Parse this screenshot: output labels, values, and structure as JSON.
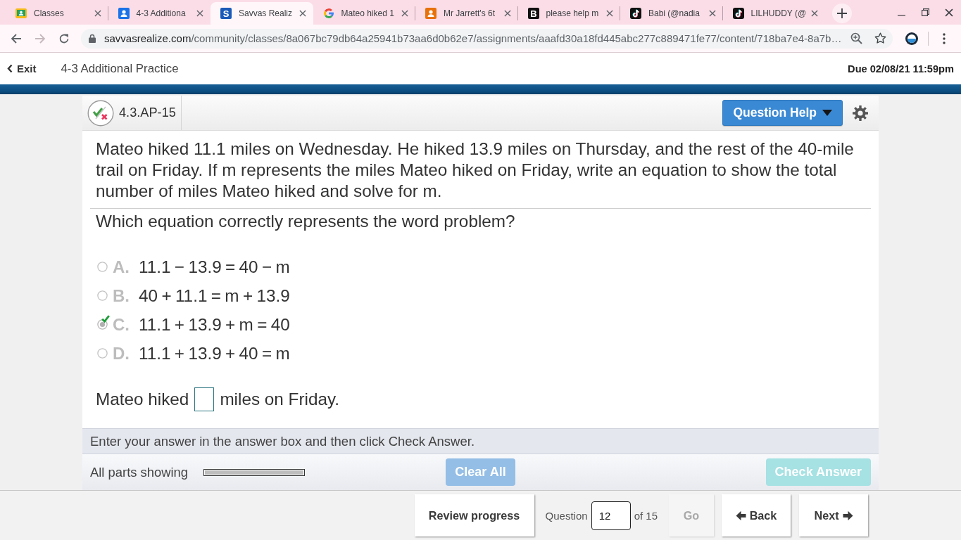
{
  "browser": {
    "tabs": [
      {
        "title": "Classes",
        "selected": false,
        "kind": "classroom"
      },
      {
        "title": "4-3 Additiona",
        "selected": false,
        "kind": "person",
        "color": "#1a73e8"
      },
      {
        "title": "Savvas Realiz",
        "selected": true,
        "kind": "letter",
        "color": "#1a5bb8",
        "icon_letter": "S"
      },
      {
        "title": "Mateo hiked 1",
        "selected": false,
        "kind": "google"
      },
      {
        "title": "Mr Jarrett's 6t",
        "selected": false,
        "kind": "person",
        "color": "#e8710a"
      },
      {
        "title": "please help m",
        "selected": false,
        "kind": "letter",
        "color": "#111111",
        "icon_letter": "B"
      },
      {
        "title": "Babi (@nadia",
        "selected": false,
        "kind": "tiktok"
      },
      {
        "title": "LILHUDDY (@",
        "selected": false,
        "kind": "tiktok"
      }
    ],
    "toolbar": {
      "forward_disabled": true,
      "host": "savvasrealize.com",
      "path": "/community/classes/8a067bc79db64a25941b73aa6d0b62e7/assignments/aaafd30a18fd445abc277c889471fe77/content/718ba7e4-8a7b…"
    }
  },
  "header": {
    "exit": "Exit",
    "title": "4-3 Additional Practice",
    "due": "Due 02/08/21 11:59pm"
  },
  "question": {
    "id": "4.3.AP-15",
    "help_button": "Question Help",
    "problem": "Mateo hiked 11.1 miles on Wednesday. He hiked 13.9 miles on Thursday, and the rest of the 40-mile trail on Friday. If m represents the miles Mateo hiked on Friday, write an equation to show the total number of miles Mateo hiked and solve for m.",
    "prompt": "Which equation correctly represents the word problem?",
    "choices": [
      {
        "letter": "A.",
        "equation": "11.1 − 13.9 = 40 − m",
        "selected": false
      },
      {
        "letter": "B.",
        "equation": "40 + 11.1 = m + 13.9",
        "selected": false
      },
      {
        "letter": "C.",
        "equation": "11.1 + 13.9 + m = 40",
        "selected": true
      },
      {
        "letter": "D.",
        "equation": "11.1 + 13.9 + 40 = m",
        "selected": false
      }
    ],
    "answer_before": "Mateo hiked",
    "answer_after": "miles on Friday.",
    "instruction": "Enter your answer in the answer box and then click Check Answer.",
    "parts_label": "All parts showing",
    "parts_progress": {
      "level": 1
    },
    "buttons": [
      {
        "label": "Clear All",
        "kind": "clear",
        "disabled": true
      },
      {
        "label": "Check Answer",
        "kind": "check",
        "disabled": true
      }
    ]
  },
  "footer": {
    "review_button": "Review progress",
    "question_label": "Question",
    "question_number": "12",
    "question_total": "of 15",
    "go": {
      "label": "Go",
      "disabled": true
    },
    "back": {
      "label": "Back",
      "disabled": false
    },
    "next": {
      "label": "Next",
      "disabled": false
    }
  }
}
